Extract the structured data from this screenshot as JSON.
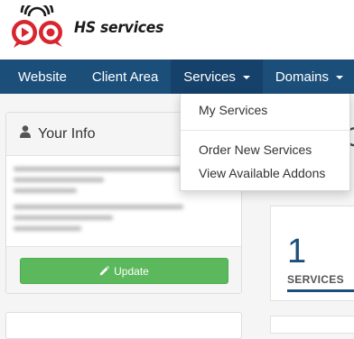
{
  "brand": {
    "name": "HS services",
    "accent_red": "#d7262f",
    "accent_dark": "#1b1b1b"
  },
  "navbar": {
    "background": "#1b4f7a",
    "items": [
      {
        "label": "Website"
      },
      {
        "label": "Client Area"
      },
      {
        "label": "Services",
        "has_dropdown": true,
        "active": true
      },
      {
        "label": "Domains",
        "has_dropdown": true
      }
    ]
  },
  "dropdown": {
    "items": [
      {
        "label": "My Services"
      },
      {
        "label": "Order New Services"
      },
      {
        "label": "View Available Addons"
      }
    ]
  },
  "your_info": {
    "title": "Your Info",
    "icon": "user-icon",
    "update_label": "Update",
    "update_icon": "pencil-icon",
    "button_color": "#5cb85c"
  },
  "stats": {
    "services_count": "1",
    "services_label": "SERVICES"
  },
  "partial_heading": "C"
}
